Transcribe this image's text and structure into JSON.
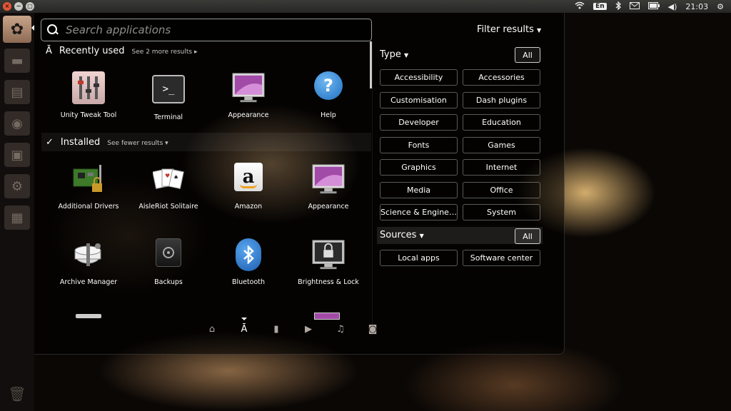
{
  "top_panel": {
    "window_buttons": [
      "×",
      "−",
      "□"
    ],
    "indicators": {
      "wifi_icon": "wifi-icon",
      "language": "En",
      "bluetooth_icon": "bluetooth-icon",
      "mail_icon": "mail-icon",
      "battery_icon": "battery-icon",
      "volume": "◀)",
      "clock": "21:03",
      "gear_icon": "gear-icon"
    }
  },
  "launcher": {
    "bfb_icon": "ubuntu-logo-icon",
    "items": [
      "home-folder-icon",
      "files-icon",
      "firefox-icon",
      "software-center-icon",
      "system-settings-icon",
      "workspace-switcher-icon",
      "trash-icon"
    ]
  },
  "dash": {
    "search_placeholder": "Search applications",
    "filter_results_label": "Filter results",
    "recently_used": {
      "title": "Recently used",
      "more": "See 2 more results",
      "apps": [
        {
          "label": "Unity Tweak Tool",
          "icon": "unity-tweak-tool-icon"
        },
        {
          "label": "Terminal",
          "icon": "terminal-icon"
        },
        {
          "label": "Appearance",
          "icon": "appearance-icon"
        },
        {
          "label": "Help",
          "icon": "help-icon"
        }
      ]
    },
    "installed": {
      "title": "Installed",
      "more": "See fewer results",
      "apps": [
        {
          "label": "Additional Drivers",
          "icon": "additional-drivers-icon"
        },
        {
          "label": "AisleRiot Solitaire",
          "icon": "solitaire-cards-icon"
        },
        {
          "label": "Amazon",
          "icon": "amazon-icon"
        },
        {
          "label": "Appearance",
          "icon": "appearance-icon"
        },
        {
          "label": "Archive Manager",
          "icon": "archive-manager-icon"
        },
        {
          "label": "Backups",
          "icon": "backups-icon"
        },
        {
          "label": "Bluetooth",
          "icon": "bluetooth-icon"
        },
        {
          "label": "Brightness & Lock",
          "icon": "brightness-lock-icon"
        }
      ]
    },
    "lenses": [
      "home-lens-icon",
      "applications-lens-icon",
      "files-lens-icon",
      "video-lens-icon",
      "music-lens-icon",
      "photos-lens-icon"
    ]
  },
  "filters": {
    "type_label": "Type",
    "all_label": "All",
    "types": [
      "Accessibility",
      "Accessories",
      "Customisation",
      "Dash plugins",
      "Developer",
      "Education",
      "Fonts",
      "Games",
      "Graphics",
      "Internet",
      "Media",
      "Office",
      "Science & Engine…",
      "System"
    ],
    "sources_label": "Sources",
    "sources": [
      "Local apps",
      "Software center"
    ]
  }
}
